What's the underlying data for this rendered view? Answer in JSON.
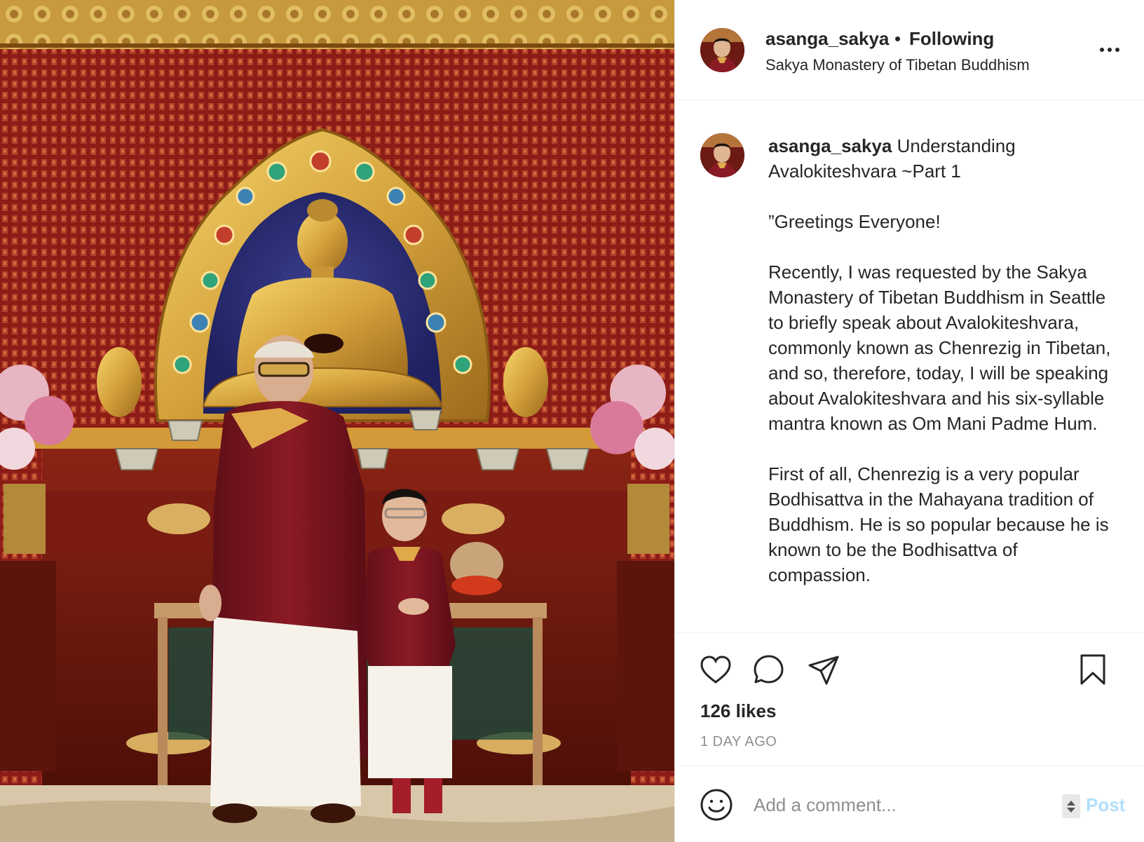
{
  "header": {
    "username": "asanga_sakya",
    "separator": "•",
    "follow_status": "Following",
    "location": "Sakya Monastery of Tibetan Buddhism",
    "more_icon": "more-horizontal-icon"
  },
  "caption": {
    "username": "asanga_sakya",
    "first_line": "Understanding Avalokiteshvara ~Part 1",
    "paragraphs": [
      "”Greetings Everyone!",
      "Recently, I was requested by the Sakya Monastery of Tibetan Buddhism in Seattle to briefly speak about Avalokiteshvara, commonly known as Chenrezig in Tibetan, and so, therefore, today, I will be speaking about Avalokiteshvara and his six-syllable mantra known as Om Mani Padme Hum.",
      "First of all, Chenrezig is a very popular Bodhisattva in the Mahayana tradition of Buddhism. He is so popular because he is known to be the Bodhisattva of compassion."
    ]
  },
  "actions": {
    "icons": [
      "heart-icon",
      "comment-icon",
      "share-icon",
      "bookmark-icon"
    ],
    "likes": "126 likes",
    "time": "1 DAY AGO"
  },
  "comment": {
    "placeholder": "Add a comment...",
    "post_label": "Post",
    "emoji_icon": "smiley-icon"
  },
  "colors": {
    "text": "#262626",
    "secondary": "#8e8e8e",
    "post_disabled": "#b2dffc",
    "divider": "#efefef"
  }
}
